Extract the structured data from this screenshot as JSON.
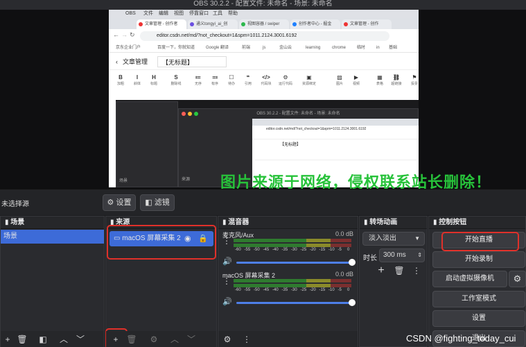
{
  "window": {
    "title": "OBS 30.2.2 - 配置文件: 未命名 - 场景: 未命名"
  },
  "capture": {
    "menubar": [
      "OBS",
      "文件",
      "编辑",
      "视图",
      "停靠窗口",
      "工具",
      "帮助"
    ],
    "tabs": [
      "文章管理 - 创作者",
      "通义tongyi_ai_创",
      "视图容器 / swiper",
      "创作者中心 - 掘金",
      "文章管理 - 创作"
    ],
    "url": "editor.csdn.net/md/?not_checkout=1&spm=1011.2124.3001.6192",
    "bookmarks": [
      "京东企业门户",
      "百度一下，你就知道",
      "Google 翻译",
      "前端",
      "js",
      "金山云",
      "learning",
      "chrome",
      "临时",
      "in",
      "基础"
    ],
    "editor_back": "文章管理",
    "editor_title": "【无标题】",
    "toolbar": [
      {
        "g": "B",
        "l": "加粗"
      },
      {
        "g": "I",
        "l": "斜体"
      },
      {
        "g": "H",
        "l": "标题"
      },
      {
        "g": "S",
        "l": "删除线"
      },
      {
        "g": "≔",
        "l": "无序"
      },
      {
        "g": "≕",
        "l": "有序"
      },
      {
        "g": "☐",
        "l": "待办"
      },
      {
        "g": "❝",
        "l": "引用"
      },
      {
        "g": "</>",
        "l": "代码块"
      },
      {
        "g": "⚙",
        "l": "运行代码"
      },
      {
        "g": "▣",
        "l": "资源绑定"
      },
      {
        "g": "▨",
        "l": "图片"
      },
      {
        "g": "▶",
        "l": "视频"
      },
      {
        "g": "▦",
        "l": "表格"
      },
      {
        "g": "⛓",
        "l": "超链接"
      },
      {
        "g": "⚑",
        "l": "投票"
      }
    ],
    "nested_title": "OBS 30.2.2 - 配置文件: 未命名 - 场景: 未命名",
    "nested_url": "editor.csdn.net/md/?not_checkout=1&spm=1011.2124.3001.6192",
    "nested_editor_title": "【无标题】",
    "nested_scene_label": "场景",
    "nested_source_label": "来源"
  },
  "watermark": "图片来源于网络，侵权联系站长删除！",
  "source_bar": {
    "status": "未选择源",
    "settings_label": "设置",
    "filters_label": "滤镜"
  },
  "scenes": {
    "title": "场景",
    "items": [
      "场景"
    ]
  },
  "sources": {
    "title": "来源",
    "items": [
      {
        "label": "macOS 屏幕采集 2"
      }
    ]
  },
  "mixer": {
    "title": "混音器",
    "ticks": [
      "-60",
      "-55",
      "-50",
      "-45",
      "-40",
      "-35",
      "-30",
      "-25",
      "-20",
      "-15",
      "-10",
      "-5",
      "0"
    ],
    "channels": [
      {
        "name": "麦克风/Aux",
        "db": "0.0 dB",
        "volume": 1.0
      },
      {
        "name": "macOS 屏幕采集 2",
        "db": "0.0 dB",
        "volume": 1.0
      }
    ]
  },
  "transitions": {
    "title": "转场动画",
    "selected": "淡入淡出",
    "duration_label": "时长",
    "duration_value": "300 ms"
  },
  "controls": {
    "title": "控制按钮",
    "start_stream": "开始直播",
    "start_record": "开始录制",
    "virtual_cam": "启动虚拟摄像机",
    "studio_mode": "工作室模式",
    "settings": "设置",
    "exit": "退出"
  },
  "csdn_watermark": "CSDN @fighting_today_cui",
  "colors": {
    "accent": "#3d6bd8",
    "highlight": "#e0302a",
    "watermark": "#27c23a"
  }
}
